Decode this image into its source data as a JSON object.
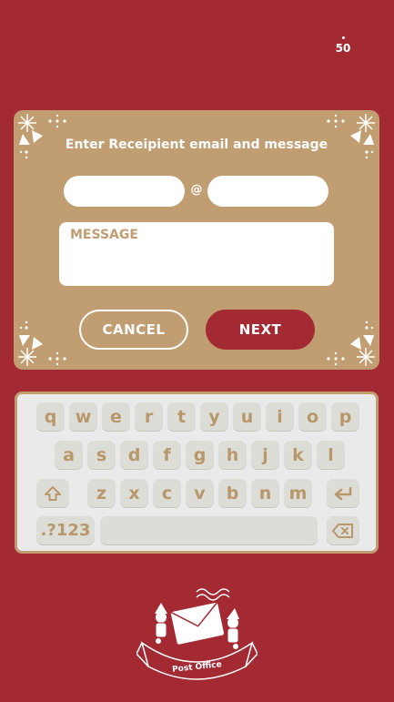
{
  "status": {
    "counter": "50"
  },
  "form": {
    "title": "Enter Receipient email and message",
    "email_user": {
      "value": "",
      "placeholder": ""
    },
    "at_symbol": "@",
    "email_domain": {
      "value": "",
      "placeholder": ""
    },
    "message": {
      "value": "",
      "placeholder": "MESSAGE"
    },
    "cancel_label": "CANCEL",
    "next_label": "NEXT"
  },
  "keyboard": {
    "row1": [
      "q",
      "w",
      "e",
      "r",
      "t",
      "y",
      "u",
      "i",
      "o",
      "p"
    ],
    "row2": [
      "a",
      "s",
      "d",
      "f",
      "g",
      "h",
      "j",
      "k",
      "l"
    ],
    "row3": [
      "z",
      "x",
      "c",
      "v",
      "b",
      "n",
      "m"
    ],
    "numbers_label": ".?123",
    "icons": {
      "shift": "shift-arrow-icon",
      "enter": "return-arrow-icon",
      "backspace": "backspace-icon"
    }
  },
  "logo": {
    "text": "Post Office"
  },
  "colors": {
    "background": "#a32a32",
    "card": "#c19d72",
    "key": "#ddddd8",
    "key_text": "#b8976b",
    "white": "#ffffff"
  }
}
